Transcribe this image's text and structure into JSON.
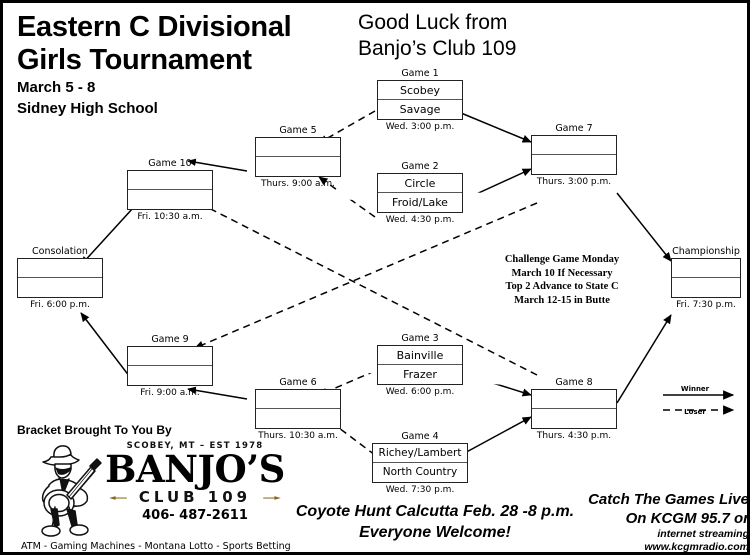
{
  "header": {
    "title_line1": "Eastern C Divisional",
    "title_line2": "Girls Tournament",
    "dates": "March 5 - 8",
    "venue": "Sidney High School",
    "good_luck_line1": "Good Luck from",
    "good_luck_line2": "Banjo’s Club 109"
  },
  "bracket": {
    "games": [
      {
        "label": "Game 1",
        "team1": "Scobey",
        "team2": "Savage",
        "time": "Wed. 3:00 p.m."
      },
      {
        "label": "Game 2",
        "team1": "Circle",
        "team2": "Froid/Lake",
        "time": "Wed. 4:30 p.m."
      },
      {
        "label": "Game 3",
        "team1": "Bainville",
        "team2": "Frazer",
        "time": "Wed. 6:00 p.m."
      },
      {
        "label": "Game 4",
        "team1": "Richey/Lambert",
        "team2": "North Country",
        "time": "Wed. 7:30 p.m."
      },
      {
        "label": "Game 5",
        "team1": "",
        "team2": "",
        "time": "Thurs. 9:00 a.m."
      },
      {
        "label": "Game 6",
        "team1": "",
        "team2": "",
        "time": "Thurs. 10:30 a.m."
      },
      {
        "label": "Game 7",
        "team1": "",
        "team2": "",
        "time": "Thurs. 3:00 p.m."
      },
      {
        "label": "Game 8",
        "team1": "",
        "team2": "",
        "time": "Thurs. 4:30 p.m."
      },
      {
        "label": "Game 9",
        "team1": "",
        "team2": "",
        "time": "Fri. 9:00 a.m."
      },
      {
        "label": "Game 10",
        "team1": "",
        "team2": "",
        "time": "Fri. 10:30 a.m."
      },
      {
        "label": "Consolation",
        "team1": "",
        "team2": "",
        "time": "Fri. 6:00 p.m."
      },
      {
        "label": "Championship",
        "team1": "",
        "team2": "",
        "time": "Fri. 7:30 p.m."
      }
    ]
  },
  "challenge_note": {
    "line1": "Challenge Game Monday",
    "line2": "March 10 If Necessary",
    "line3": "Top 2 Advance to State C",
    "line4": "March 12-15 in Butte"
  },
  "legend": {
    "winner_label": "Winner",
    "loser_label": "Loser"
  },
  "sponsor": {
    "bracket_by": "Bracket Brought To You By",
    "est_line": "SCOBEY, MT – EST 1978",
    "name": "BANJO’S",
    "club": "CLUB 109",
    "phone": "406- 487-2611",
    "services": "ATM - Gaming Machines - Montana Lotto -  Sports Betting"
  },
  "promos": {
    "coyote_line1": "Coyote Hunt Calcutta Feb. 28 -8 p.m.",
    "coyote_line2": "Everyone Welcome!",
    "radio_line1": "Catch The Games Live",
    "radio_line2": "On KCGM 95.7 or",
    "radio_line3": "internet streaming",
    "radio_line4": "www.kcgmradio.com"
  },
  "colors": {
    "ink": "#000000",
    "paper": "#ffffff",
    "box_border": "#222222",
    "logo_arrow": "#8a6a1e"
  }
}
